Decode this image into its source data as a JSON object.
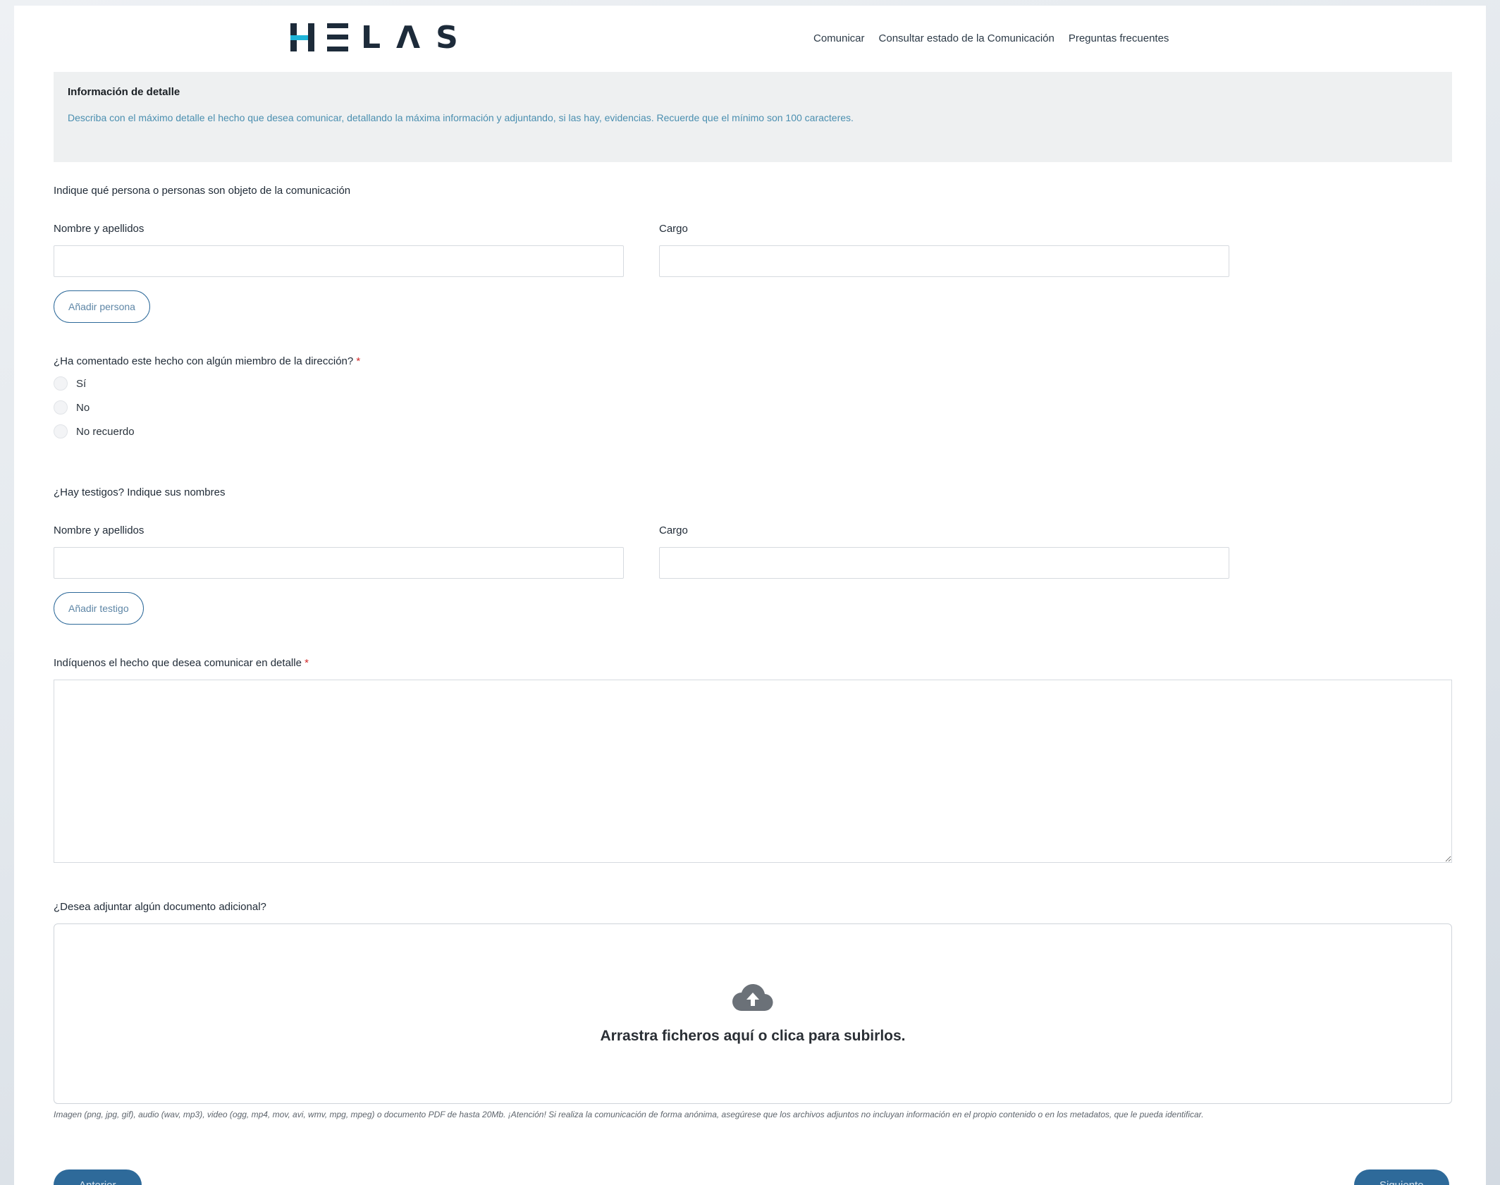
{
  "header": {
    "logo_text": "HELAS",
    "nav": [
      "Comunicar",
      "Consultar estado de la Comunicación",
      "Preguntas frecuentes"
    ]
  },
  "info": {
    "title": "Información de detalle",
    "description": "Describa con el máximo detalle el hecho que desea comunicar, detallando la máxima información y adjuntando, si las hay, evidencias. Recuerde que el mínimo son 100 caracteres."
  },
  "persons": {
    "question": "Indique qué persona o personas son objeto de la comunicación",
    "name_label": "Nombre y apellidos",
    "role_label": "Cargo",
    "name_value": "",
    "role_value": "",
    "add_label": "Añadir persona"
  },
  "direction": {
    "question": "¿Ha comentado este hecho con algún miembro de la dirección?",
    "required_mark": "*",
    "options": [
      "Sí",
      "No",
      "No recuerdo"
    ]
  },
  "witnesses": {
    "question": "¿Hay testigos? Indique sus nombres",
    "name_label": "Nombre y apellidos",
    "role_label": "Cargo",
    "name_value": "",
    "role_value": "",
    "add_label": "Añadir testigo"
  },
  "detail": {
    "label": "Indíquenos el hecho que desea comunicar en detalle",
    "required_mark": "*",
    "value": ""
  },
  "attachments": {
    "question": "¿Desea adjuntar algún documento adicional?",
    "dropzone_text": "Arrastra ficheros aquí o clica para subirlos.",
    "note": "Imagen (png, jpg, gif), audio (wav, mp3), video (ogg, mp4, mov, avi, wmv, mpg, mpeg) o documento PDF de hasta 20Mb. ¡Atención! Si realiza la comunicación de forma anónima, asegúrese que los archivos adjuntos no incluyan información en el propio contenido o en los metadatos, que le pueda identificar."
  },
  "footer": {
    "prev_label": "Anterior",
    "next_label": "Siguiente"
  },
  "colors": {
    "primary": "#2e6a9a",
    "accent": "#1fb4d8",
    "info_text": "#4b8fb0",
    "required": "#d12a2a"
  }
}
